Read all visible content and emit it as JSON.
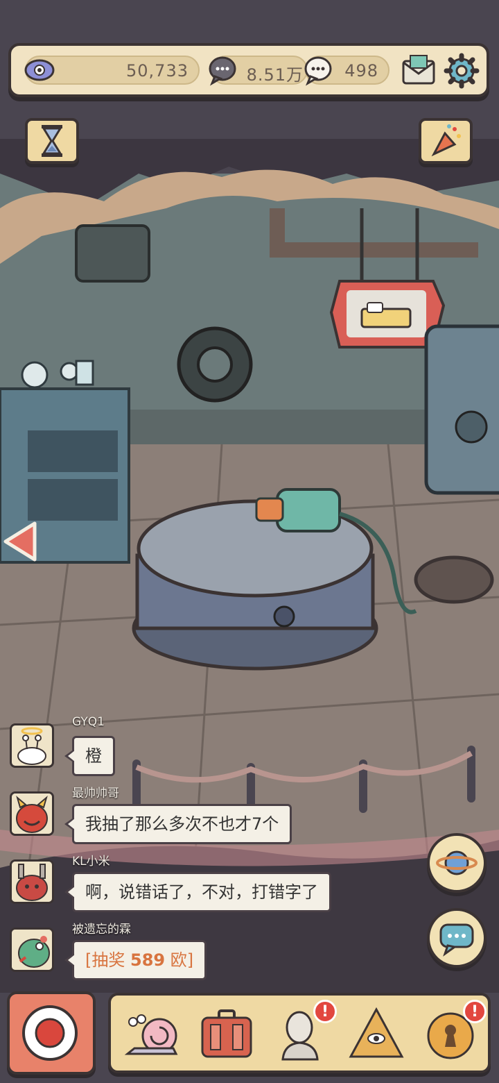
{
  "resources": {
    "eye_value": "50,733",
    "gray_bubble_value": "8.51万",
    "white_bubble_value": "498"
  },
  "icons": {
    "eye": "eye-icon",
    "gray_bubble": "speech-bubble-icon",
    "white_bubble": "chat-bubble-icon",
    "mail": "mail-icon",
    "settings": "gear-icon",
    "hourglass": "hourglass-icon",
    "party": "party-popper-icon",
    "sign": "bed-icon",
    "arrow": "arrow-left-icon",
    "planet": "planet-icon",
    "chat": "chat-icon"
  },
  "chat": [
    {
      "name": "GYQ1",
      "message": "橙"
    },
    {
      "name": "最帅帅哥",
      "message": "我抽了那么多次不也才7个"
    },
    {
      "name": "KL小米",
      "message": "啊，说错话了，不对，打错字了"
    },
    {
      "name": "被遗忘的霖",
      "message_prefix": "[抽奖 ",
      "message_number": "589",
      "message_suffix": " 欧]"
    }
  ],
  "nav": [
    {
      "name": "snail-icon",
      "badge": ""
    },
    {
      "name": "suitcase-icon",
      "badge": ""
    },
    {
      "name": "statue-icon",
      "badge": "!"
    },
    {
      "name": "pyramid-eye-icon",
      "badge": ""
    },
    {
      "name": "keyhole-icon",
      "badge": "!"
    }
  ],
  "colors": {
    "panel": "#f1e3c3",
    "outline": "#3b3333",
    "badge": "#e2473f",
    "accent_number": "#d8743f"
  }
}
